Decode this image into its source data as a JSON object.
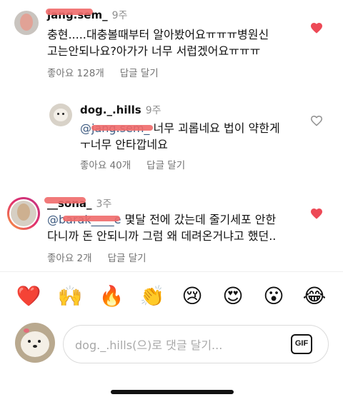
{
  "comments": [
    {
      "username": "jang.sem_",
      "time": "9주",
      "line1": "충현.....대충볼때부터 알아봤어요ㅠㅠㅠ병원신",
      "line2": "고는안되나요?아가가 너무 서럽겠어요ㅠㅠㅠ",
      "likes": "좋아요 128개",
      "reply_label": "답글 달기",
      "liked": true
    },
    {
      "username": "dog._.hills",
      "time": "9주",
      "mention": "@jang.sem_",
      "line1": " 너무 괴롭네요 법이 약한게",
      "line2": "ㅜ너무 안타깝네요",
      "likes": "좋아요 40개",
      "reply_label": "답글 달기",
      "liked": false
    },
    {
      "username": "__sona_",
      "time": "3주",
      "mention": "@barak____e",
      "line1": "  몇달 전에 갔는데 줄기세포 안한",
      "line2": "다니까 돈 안되니까 그럼 왜 데려온거냐고 했던..",
      "likes": "좋아요 2개",
      "reply_label": "답글 달기",
      "liked": true
    }
  ],
  "reactions": [
    {
      "emoji": "❤️",
      "name": "heart-emoji"
    },
    {
      "emoji": "🙌",
      "name": "raised-hands-emoji"
    },
    {
      "emoji": "🔥",
      "name": "fire-emoji"
    },
    {
      "emoji": "👏",
      "name": "clapping-emoji"
    },
    {
      "emoji": "😢",
      "name": "crying-emoji"
    },
    {
      "emoji": "😍",
      "name": "heart-eyes-emoji"
    },
    {
      "emoji": "😮",
      "name": "surprised-emoji"
    },
    {
      "emoji": "😂",
      "name": "laughing-emoji"
    }
  ],
  "composer": {
    "placeholder": "dog._.hills(으)로 댓글 달기...",
    "gif_label": "GIF"
  },
  "colors": {
    "like_red": "#ed4956",
    "mention_blue": "#3d5a80",
    "muted": "#737373"
  }
}
